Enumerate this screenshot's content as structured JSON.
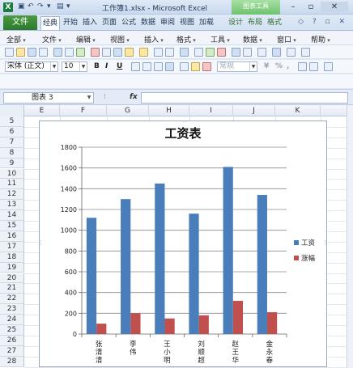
{
  "window": {
    "title": "工作簿1.xlsx - Microsoft Excel",
    "context_tools_label": "图表工具",
    "app_icon": "excel-icon"
  },
  "ribbon": {
    "file_label": "文件",
    "tabs": [
      "经典",
      "开始",
      "插入",
      "页面",
      "公式",
      "数据",
      "审阅",
      "视图",
      "加载",
      "设计",
      "布局",
      "格式"
    ],
    "active_tab": "经典"
  },
  "menus": [
    "全部",
    "文件",
    "编辑",
    "视图",
    "插入",
    "格式",
    "工具",
    "数据",
    "窗口",
    "帮助"
  ],
  "toolbar": {
    "font_name": "宋体 (正文)",
    "font_size": "10",
    "bold": "B",
    "italic": "I",
    "underline": "U",
    "number_format": "常规",
    "percent": "%",
    "comma": ","
  },
  "formula_bar": {
    "name_box": "图表 3",
    "fx_label": "fx",
    "formula": ""
  },
  "columns": [
    "E",
    "F",
    "G",
    "H",
    "I",
    "J",
    "K"
  ],
  "rows": [
    "5",
    "6",
    "7",
    "8",
    "9",
    "10",
    "11",
    "12",
    "13",
    "14",
    "15",
    "16",
    "17",
    "18",
    "19",
    "20",
    "21",
    "22",
    "23",
    "24",
    "25",
    "26",
    "27",
    "28"
  ],
  "chart_data": {
    "type": "bar",
    "title": "工资表",
    "categories": [
      "张清清",
      "李伟",
      "王小明",
      "刘顺超",
      "赵王华",
      "金永春"
    ],
    "series": [
      {
        "name": "工资",
        "color": "#4a7ebb",
        "values": [
          1120,
          1300,
          1450,
          1160,
          1610,
          1340
        ]
      },
      {
        "name": "涨幅",
        "color": "#c0504d",
        "values": [
          100,
          200,
          150,
          180,
          320,
          210
        ]
      }
    ],
    "ylim": [
      0,
      1800
    ],
    "yticks": [
      0,
      200,
      400,
      600,
      800,
      1000,
      1200,
      1400,
      1600,
      1800
    ],
    "grid": true,
    "legend_position": "right"
  }
}
